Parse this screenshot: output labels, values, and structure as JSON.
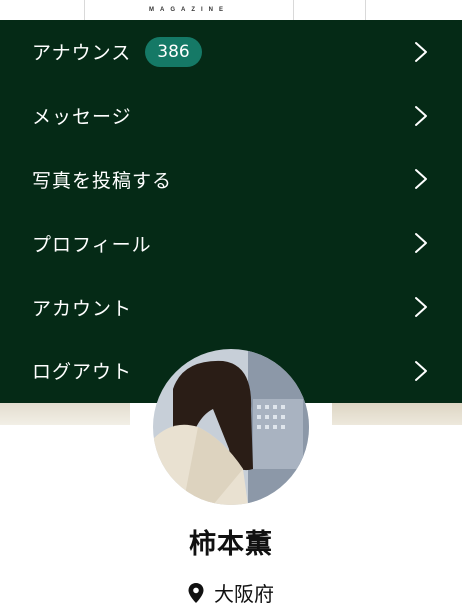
{
  "header": {
    "magazine_label": "MAGAZINE"
  },
  "menu": {
    "items": [
      {
        "label": "アナウンス",
        "badge": "386"
      },
      {
        "label": "メッセージ"
      },
      {
        "label": "写真を投稿する"
      },
      {
        "label": "プロフィール"
      },
      {
        "label": "アカウント"
      },
      {
        "label": "ログアウト"
      }
    ],
    "chevron_icon": "chevron-right-icon",
    "colors": {
      "background": "#052a16",
      "badge": "#157966",
      "text": "#ffffff"
    }
  },
  "profile": {
    "name": "柿本薫",
    "location": "大阪府",
    "location_icon": "map-pin-icon"
  }
}
